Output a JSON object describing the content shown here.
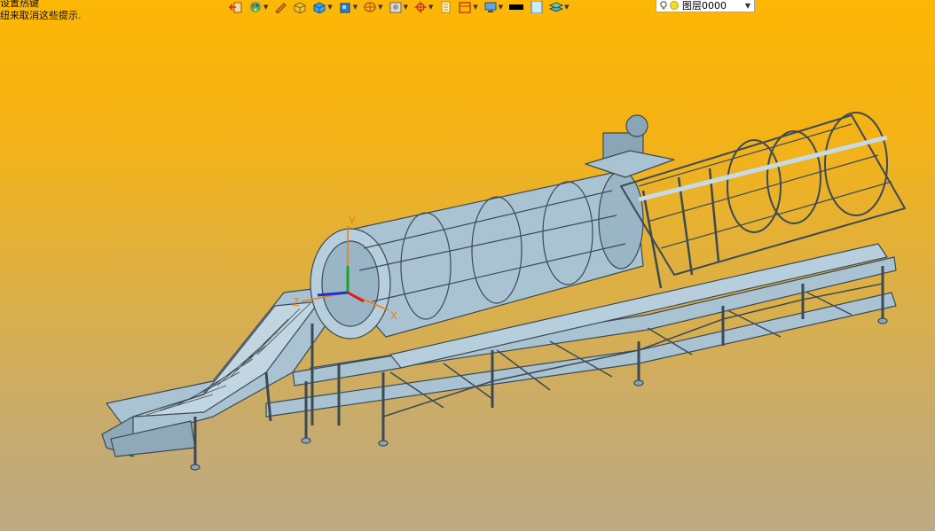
{
  "hint": {
    "line1": "设置热键",
    "line2": "纽来取消这些提示."
  },
  "toolbar": {
    "icons": [
      "exit-icon",
      "color-palette-icon",
      "pencil-icon",
      "solid-box-icon",
      "cube-icon",
      "view-cube-icon",
      "render-mode-icon",
      "snapshot-icon",
      "snap-target-icon",
      "document-icon",
      "frame-icon",
      "display-icon",
      "line-color-icon",
      "fill-color-icon",
      "layer-manager-icon"
    ],
    "layer_select_value": "图层0000"
  },
  "viewport": {
    "axis_labels": {
      "y": "Y",
      "x": "X",
      "z": "Z"
    },
    "background_top": "#fdb705",
    "background_bottom": "#bdaa82",
    "model_color": "#a9c3d2",
    "edge_color": "#3c4a55"
  }
}
